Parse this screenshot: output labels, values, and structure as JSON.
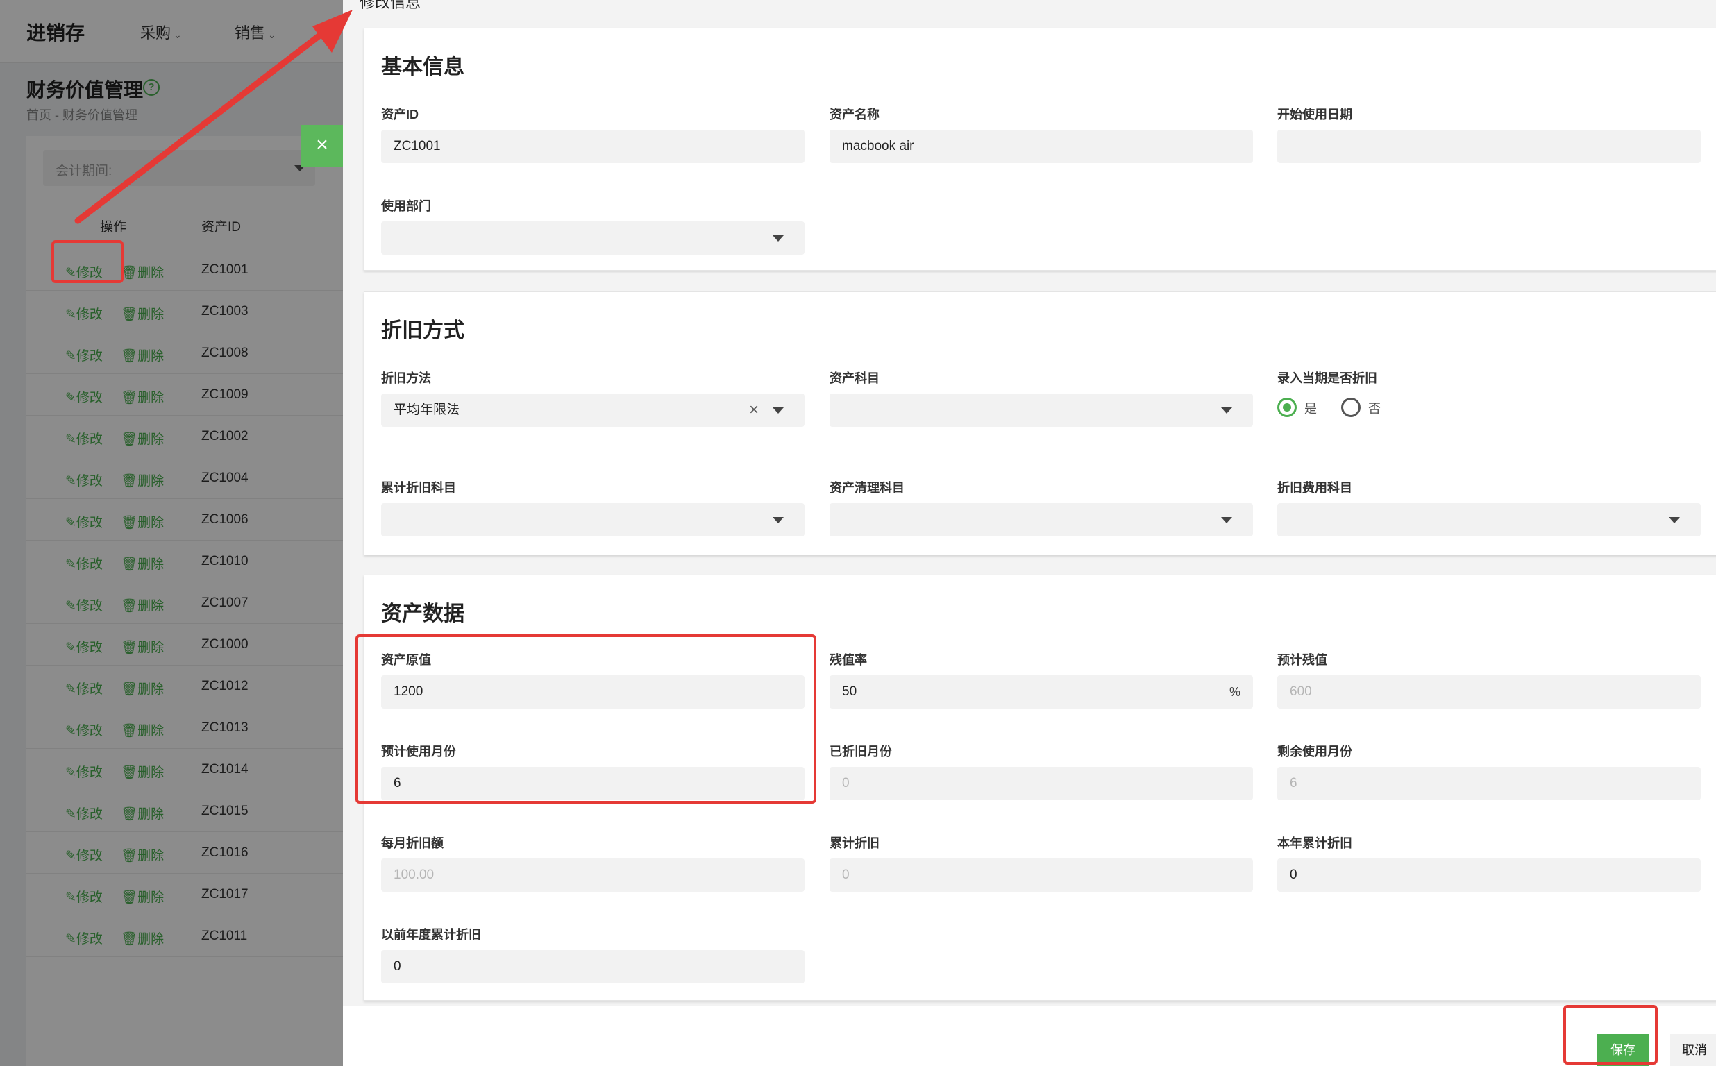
{
  "app": {
    "title": "进销存",
    "nav": [
      {
        "label": "采购",
        "chev": "⌄"
      },
      {
        "label": "销售",
        "chev": "⌄"
      }
    ]
  },
  "page": {
    "title": "财务价值管理",
    "breadcrumb": "首页 - 财务价值管理",
    "period_placeholder": "会计期间:"
  },
  "list": {
    "headers": [
      "操作",
      "资产ID"
    ],
    "edit_label": "修改",
    "delete_label": "删除",
    "rows": [
      "ZC1001",
      "ZC1003",
      "ZC1008",
      "ZC1009",
      "ZC1002",
      "ZC1004",
      "ZC1006",
      "ZC1010",
      "ZC1007",
      "ZC1000",
      "ZC1012",
      "ZC1013",
      "ZC1014",
      "ZC1015",
      "ZC1016",
      "ZC1017",
      "ZC1011"
    ]
  },
  "drawer": {
    "title": "修改信息",
    "close": "×",
    "basic": {
      "title": "基本信息",
      "asset_id_label": "资产ID",
      "asset_id": "ZC1001",
      "asset_name_label": "资产名称",
      "asset_name": "macbook air",
      "start_date_label": "开始使用日期",
      "start_date": "",
      "dept_label": "使用部门",
      "dept": ""
    },
    "depreciation": {
      "title": "折旧方式",
      "method_label": "折旧方法",
      "method": "平均年限法",
      "subject_label": "资产科目",
      "subject": "",
      "current_label": "录入当期是否折旧",
      "yes": "是",
      "no": "否",
      "accum_subject_label": "累计折旧科目",
      "accum_subject": "",
      "clear_subject_label": "资产清理科目",
      "clear_subject": "",
      "expense_subject_label": "折旧费用科目",
      "expense_subject": ""
    },
    "data": {
      "title": "资产数据",
      "original_label": "资产原值",
      "original": "1200",
      "residual_rate_label": "残值率",
      "residual_rate": "50",
      "residual_rate_unit": "%",
      "est_residual_label": "预计残值",
      "est_residual": "600",
      "months_label": "预计使用月份",
      "months": "6",
      "depreciated_months_label": "已折旧月份",
      "depreciated_months": "0",
      "remaining_months_label": "剩余使用月份",
      "remaining_months": "6",
      "monthly_label": "每月折旧额",
      "monthly": "100.00",
      "accum_label": "累计折旧",
      "accum": "0",
      "year_accum_label": "本年累计折旧",
      "year_accum": "0",
      "prior_accum_label": "以前年度累计折旧",
      "prior_accum": "0"
    },
    "save": "保存",
    "cancel": "取消"
  },
  "colors": {
    "accent": "#4caf50",
    "highlight": "#e53935"
  }
}
